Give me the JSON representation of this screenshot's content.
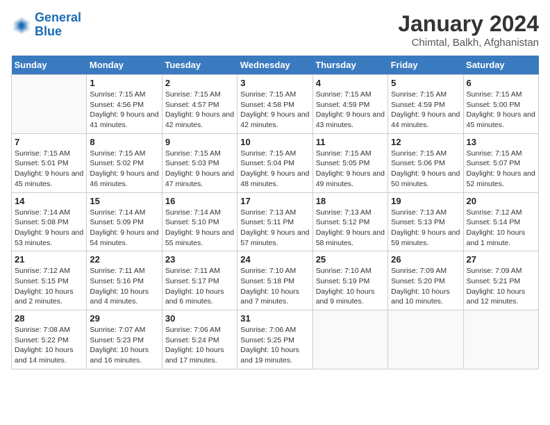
{
  "header": {
    "logo_line1": "General",
    "logo_line2": "Blue",
    "month": "January 2024",
    "location": "Chimtal, Balkh, Afghanistan"
  },
  "days_of_week": [
    "Sunday",
    "Monday",
    "Tuesday",
    "Wednesday",
    "Thursday",
    "Friday",
    "Saturday"
  ],
  "weeks": [
    [
      {
        "day": "",
        "info": ""
      },
      {
        "day": "1",
        "sunrise": "7:15 AM",
        "sunset": "4:56 PM",
        "daylight": "9 hours and 41 minutes."
      },
      {
        "day": "2",
        "sunrise": "7:15 AM",
        "sunset": "4:57 PM",
        "daylight": "9 hours and 42 minutes."
      },
      {
        "day": "3",
        "sunrise": "7:15 AM",
        "sunset": "4:58 PM",
        "daylight": "9 hours and 42 minutes."
      },
      {
        "day": "4",
        "sunrise": "7:15 AM",
        "sunset": "4:59 PM",
        "daylight": "9 hours and 43 minutes."
      },
      {
        "day": "5",
        "sunrise": "7:15 AM",
        "sunset": "4:59 PM",
        "daylight": "9 hours and 44 minutes."
      },
      {
        "day": "6",
        "sunrise": "7:15 AM",
        "sunset": "5:00 PM",
        "daylight": "9 hours and 45 minutes."
      }
    ],
    [
      {
        "day": "7",
        "sunrise": "7:15 AM",
        "sunset": "5:01 PM",
        "daylight": "9 hours and 45 minutes."
      },
      {
        "day": "8",
        "sunrise": "7:15 AM",
        "sunset": "5:02 PM",
        "daylight": "9 hours and 46 minutes."
      },
      {
        "day": "9",
        "sunrise": "7:15 AM",
        "sunset": "5:03 PM",
        "daylight": "9 hours and 47 minutes."
      },
      {
        "day": "10",
        "sunrise": "7:15 AM",
        "sunset": "5:04 PM",
        "daylight": "9 hours and 48 minutes."
      },
      {
        "day": "11",
        "sunrise": "7:15 AM",
        "sunset": "5:05 PM",
        "daylight": "9 hours and 49 minutes."
      },
      {
        "day": "12",
        "sunrise": "7:15 AM",
        "sunset": "5:06 PM",
        "daylight": "9 hours and 50 minutes."
      },
      {
        "day": "13",
        "sunrise": "7:15 AM",
        "sunset": "5:07 PM",
        "daylight": "9 hours and 52 minutes."
      }
    ],
    [
      {
        "day": "14",
        "sunrise": "7:14 AM",
        "sunset": "5:08 PM",
        "daylight": "9 hours and 53 minutes."
      },
      {
        "day": "15",
        "sunrise": "7:14 AM",
        "sunset": "5:09 PM",
        "daylight": "9 hours and 54 minutes."
      },
      {
        "day": "16",
        "sunrise": "7:14 AM",
        "sunset": "5:10 PM",
        "daylight": "9 hours and 55 minutes."
      },
      {
        "day": "17",
        "sunrise": "7:13 AM",
        "sunset": "5:11 PM",
        "daylight": "9 hours and 57 minutes."
      },
      {
        "day": "18",
        "sunrise": "7:13 AM",
        "sunset": "5:12 PM",
        "daylight": "9 hours and 58 minutes."
      },
      {
        "day": "19",
        "sunrise": "7:13 AM",
        "sunset": "5:13 PM",
        "daylight": "9 hours and 59 minutes."
      },
      {
        "day": "20",
        "sunrise": "7:12 AM",
        "sunset": "5:14 PM",
        "daylight": "10 hours and 1 minute."
      }
    ],
    [
      {
        "day": "21",
        "sunrise": "7:12 AM",
        "sunset": "5:15 PM",
        "daylight": "10 hours and 2 minutes."
      },
      {
        "day": "22",
        "sunrise": "7:11 AM",
        "sunset": "5:16 PM",
        "daylight": "10 hours and 4 minutes."
      },
      {
        "day": "23",
        "sunrise": "7:11 AM",
        "sunset": "5:17 PM",
        "daylight": "10 hours and 6 minutes."
      },
      {
        "day": "24",
        "sunrise": "7:10 AM",
        "sunset": "5:18 PM",
        "daylight": "10 hours and 7 minutes."
      },
      {
        "day": "25",
        "sunrise": "7:10 AM",
        "sunset": "5:19 PM",
        "daylight": "10 hours and 9 minutes."
      },
      {
        "day": "26",
        "sunrise": "7:09 AM",
        "sunset": "5:20 PM",
        "daylight": "10 hours and 10 minutes."
      },
      {
        "day": "27",
        "sunrise": "7:09 AM",
        "sunset": "5:21 PM",
        "daylight": "10 hours and 12 minutes."
      }
    ],
    [
      {
        "day": "28",
        "sunrise": "7:08 AM",
        "sunset": "5:22 PM",
        "daylight": "10 hours and 14 minutes."
      },
      {
        "day": "29",
        "sunrise": "7:07 AM",
        "sunset": "5:23 PM",
        "daylight": "10 hours and 16 minutes."
      },
      {
        "day": "30",
        "sunrise": "7:06 AM",
        "sunset": "5:24 PM",
        "daylight": "10 hours and 17 minutes."
      },
      {
        "day": "31",
        "sunrise": "7:06 AM",
        "sunset": "5:25 PM",
        "daylight": "10 hours and 19 minutes."
      },
      {
        "day": "",
        "info": ""
      },
      {
        "day": "",
        "info": ""
      },
      {
        "day": "",
        "info": ""
      }
    ]
  ]
}
